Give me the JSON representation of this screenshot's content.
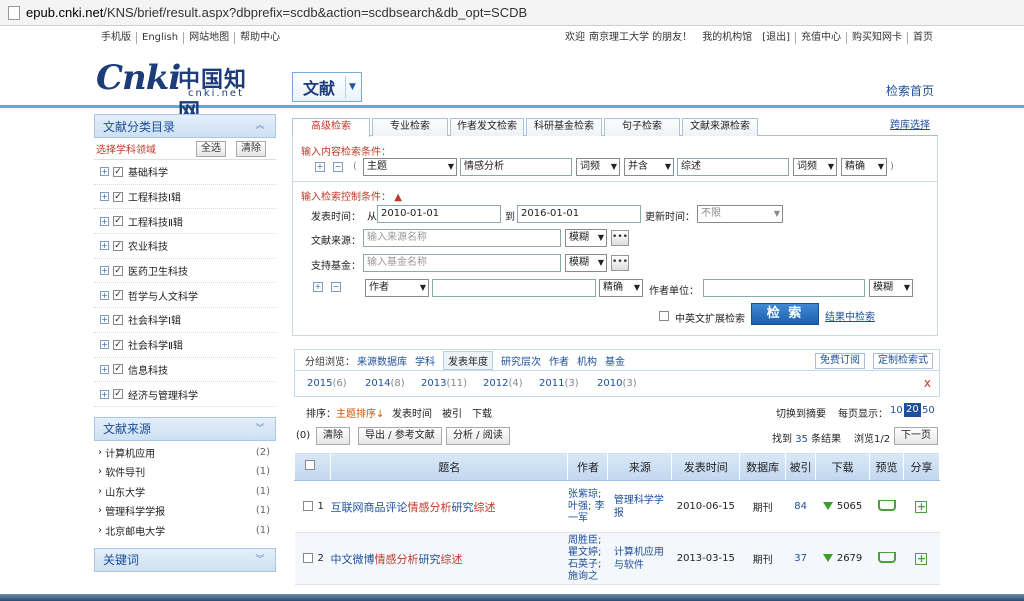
{
  "browser": {
    "url_host": "epub.cnki.net",
    "url_path": "/KNS/brief/result.aspx?dbprefix=scdb&action=scdbsearch&db_opt=SCDB"
  },
  "toplinks": {
    "left": [
      "手机版",
      "English",
      "网站地图",
      "帮助中心"
    ],
    "right": [
      "欢迎",
      "南京理工大学 的朋友！",
      "我的机构馆",
      "[退出]",
      "充值中心",
      "购买知网卡",
      "首页"
    ]
  },
  "header": {
    "logo_cn": "Cnki",
    "logo_han": "中国知网",
    "logo_sub": "cnki.net",
    "db_select": "文献",
    "home_link": "检索首页"
  },
  "sidebar": {
    "cat_title": "文献分类目录",
    "select_label": "选择学科领域",
    "select_all": "全选",
    "clear": "清除",
    "categories": [
      "基础科学",
      "工程科技Ⅰ辑",
      "工程科技Ⅱ辑",
      "农业科技",
      "医药卫生科技",
      "哲学与人文科学",
      "社会科学Ⅰ辑",
      "社会科学Ⅱ辑",
      "信息科技",
      "经济与管理科学"
    ],
    "src_title": "文献来源",
    "sources": [
      {
        "name": "计算机应用",
        "count": "(2)"
      },
      {
        "name": "软件导刊",
        "count": "(1)"
      },
      {
        "name": "山东大学",
        "count": "(1)"
      },
      {
        "name": "管理科学学报",
        "count": "(1)"
      },
      {
        "name": "北京邮电大学",
        "count": "(1)"
      }
    ],
    "kw_title": "关键词"
  },
  "tabs": [
    "高级检索",
    "专业检索",
    "作者发文检索",
    "科研基金检索",
    "句子检索",
    "文献来源检索"
  ],
  "route": "跨库选择",
  "content": {
    "title": "输入内容检索条件：",
    "field1": "主题",
    "value1": "情感分析",
    "freq1": "词频",
    "logic": "并含",
    "value2": "综述",
    "freq2": "词频",
    "precise": "精确"
  },
  "control": {
    "title": "输入检索控制条件：",
    "pub_time_label": "发表时间：",
    "from": "从",
    "from_date": "2010-01-01",
    "to": "到",
    "to_date": "2016-01-01",
    "update_label": "更新时间：",
    "update_value": "不限",
    "source_label": "文献来源：",
    "source_ph": "输入来源名称",
    "fuzzy": "模糊",
    "fund_label": "支持基金：",
    "fund_ph": "输入基金名称",
    "author_field": "作者",
    "author_match": "精确",
    "org_label": "作者单位：",
    "org_match": "模糊",
    "expand_label": "中英文扩展检索",
    "search_btn": "检 索",
    "result_search": "结果中检索"
  },
  "groups": {
    "label": "分组浏览：",
    "items": [
      "来源数据库",
      "学科",
      "发表年度",
      "研究层次",
      "作者",
      "机构",
      "基金"
    ],
    "subscribe": "免费订阅",
    "custom": "定制检索式",
    "years": [
      {
        "y": "2015",
        "n": "(6)"
      },
      {
        "y": "2014",
        "n": "(8)"
      },
      {
        "y": "2013",
        "n": "(11)"
      },
      {
        "y": "2012",
        "n": "(4)"
      },
      {
        "y": "2011",
        "n": "(3)"
      },
      {
        "y": "2010",
        "n": "(3)"
      }
    ],
    "close": "x"
  },
  "sort": {
    "label": "排序：",
    "topic": "主题排序",
    "time": "发表时间",
    "cited": "被引",
    "download": "下载",
    "switch": "切换到摘要",
    "per_page": "每页显示：",
    "pp10": "10",
    "pp20": "20",
    "pp50": "50"
  },
  "actions": {
    "selected": "(0)",
    "clear": "清除",
    "export": "导出 / 参考文献",
    "analyze": "分析 / 阅读",
    "found_pre": "找到",
    "found_num": "35",
    "found_post": "条结果",
    "page_info": "浏览1/2",
    "next": "下一页"
  },
  "table": {
    "headers": [
      "题名",
      "作者",
      "来源",
      "发表时间",
      "数据库",
      "被引",
      "下载",
      "预览",
      "分享"
    ],
    "rows": [
      {
        "num": "1",
        "title_a": "互联网商品评论",
        "title_hl1": "情感分析",
        "title_b": "研究",
        "title_hl2": "综述",
        "authors": "张紫琼; 叶强; 李一军",
        "source": "管理科学学报",
        "date": "2010-06-15",
        "db": "期刊",
        "cited": "84",
        "downloads": "5065"
      },
      {
        "num": "2",
        "title_a": "中文微博",
        "title_hl1": "情感分析",
        "title_b": "研究",
        "title_hl2": "综述",
        "authors": "周胜臣; 瞿文婷; 石英子; 施询之",
        "source": "计算机应用与软件",
        "date": "2013-03-15",
        "db": "期刊",
        "cited": "37",
        "downloads": "2679"
      }
    ]
  }
}
